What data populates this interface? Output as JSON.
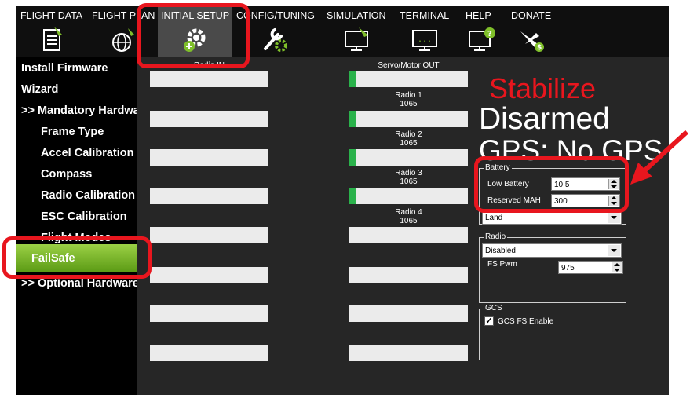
{
  "toolbar": {
    "items": [
      {
        "label": "FLIGHT DATA",
        "icon": "flight-data-icon"
      },
      {
        "label": "FLIGHT PLAN",
        "icon": "flight-plan-icon"
      },
      {
        "label": "INITIAL SETUP",
        "icon": "initial-setup-icon"
      },
      {
        "label": "CONFIG/TUNING",
        "icon": "config-tuning-icon"
      },
      {
        "label": "SIMULATION",
        "icon": "simulation-icon"
      },
      {
        "label": "TERMINAL",
        "icon": "terminal-icon"
      },
      {
        "label": "HELP",
        "icon": "help-icon"
      },
      {
        "label": "DONATE",
        "icon": "donate-icon"
      }
    ]
  },
  "sidebar": {
    "items": [
      {
        "label": "Install Firmware"
      },
      {
        "label": "Wizard"
      },
      {
        "label": ">> Mandatory Hardware"
      },
      {
        "label": "Frame Type"
      },
      {
        "label": "Accel Calibration"
      },
      {
        "label": "Compass"
      },
      {
        "label": "Radio Calibration"
      },
      {
        "label": "ESC Calibration"
      },
      {
        "label": "Flight Modes"
      },
      {
        "label": "FailSafe"
      },
      {
        "label": ">> Optional Hardware"
      }
    ]
  },
  "main": {
    "radio_in_label": "Radio IN",
    "servo_out_label": "Servo/Motor OUT",
    "radios": [
      {
        "name": "Radio 1",
        "value": "1065",
        "fill": 0.06
      },
      {
        "name": "Radio 2",
        "value": "1065",
        "fill": 0.06
      },
      {
        "name": "Radio 3",
        "value": "1065",
        "fill": 0.06
      },
      {
        "name": "Radio 4",
        "value": "1065",
        "fill": 0
      }
    ],
    "servo_top_fill": 0.06,
    "hud": {
      "mode": "Stabilize",
      "armed": "Disarmed",
      "gps": "GPS: No GPS"
    },
    "battery": {
      "title": "Battery",
      "low_label": "Low Battery",
      "low_value": "10.5",
      "reserved_label": "Reserved MAH",
      "reserved_value": "300",
      "action": "Land"
    },
    "radio_fs": {
      "title": "Radio",
      "mode": "Disabled",
      "pwm_label": "FS Pwm",
      "pwm_value": "975"
    },
    "gcs": {
      "title": "GCS",
      "enable_label": "GCS FS Enable",
      "checked": true
    }
  },
  "colors": {
    "accent_green": "#7fbf2a",
    "highlight_red": "#e8161e",
    "hud_red": "#e8161e"
  }
}
